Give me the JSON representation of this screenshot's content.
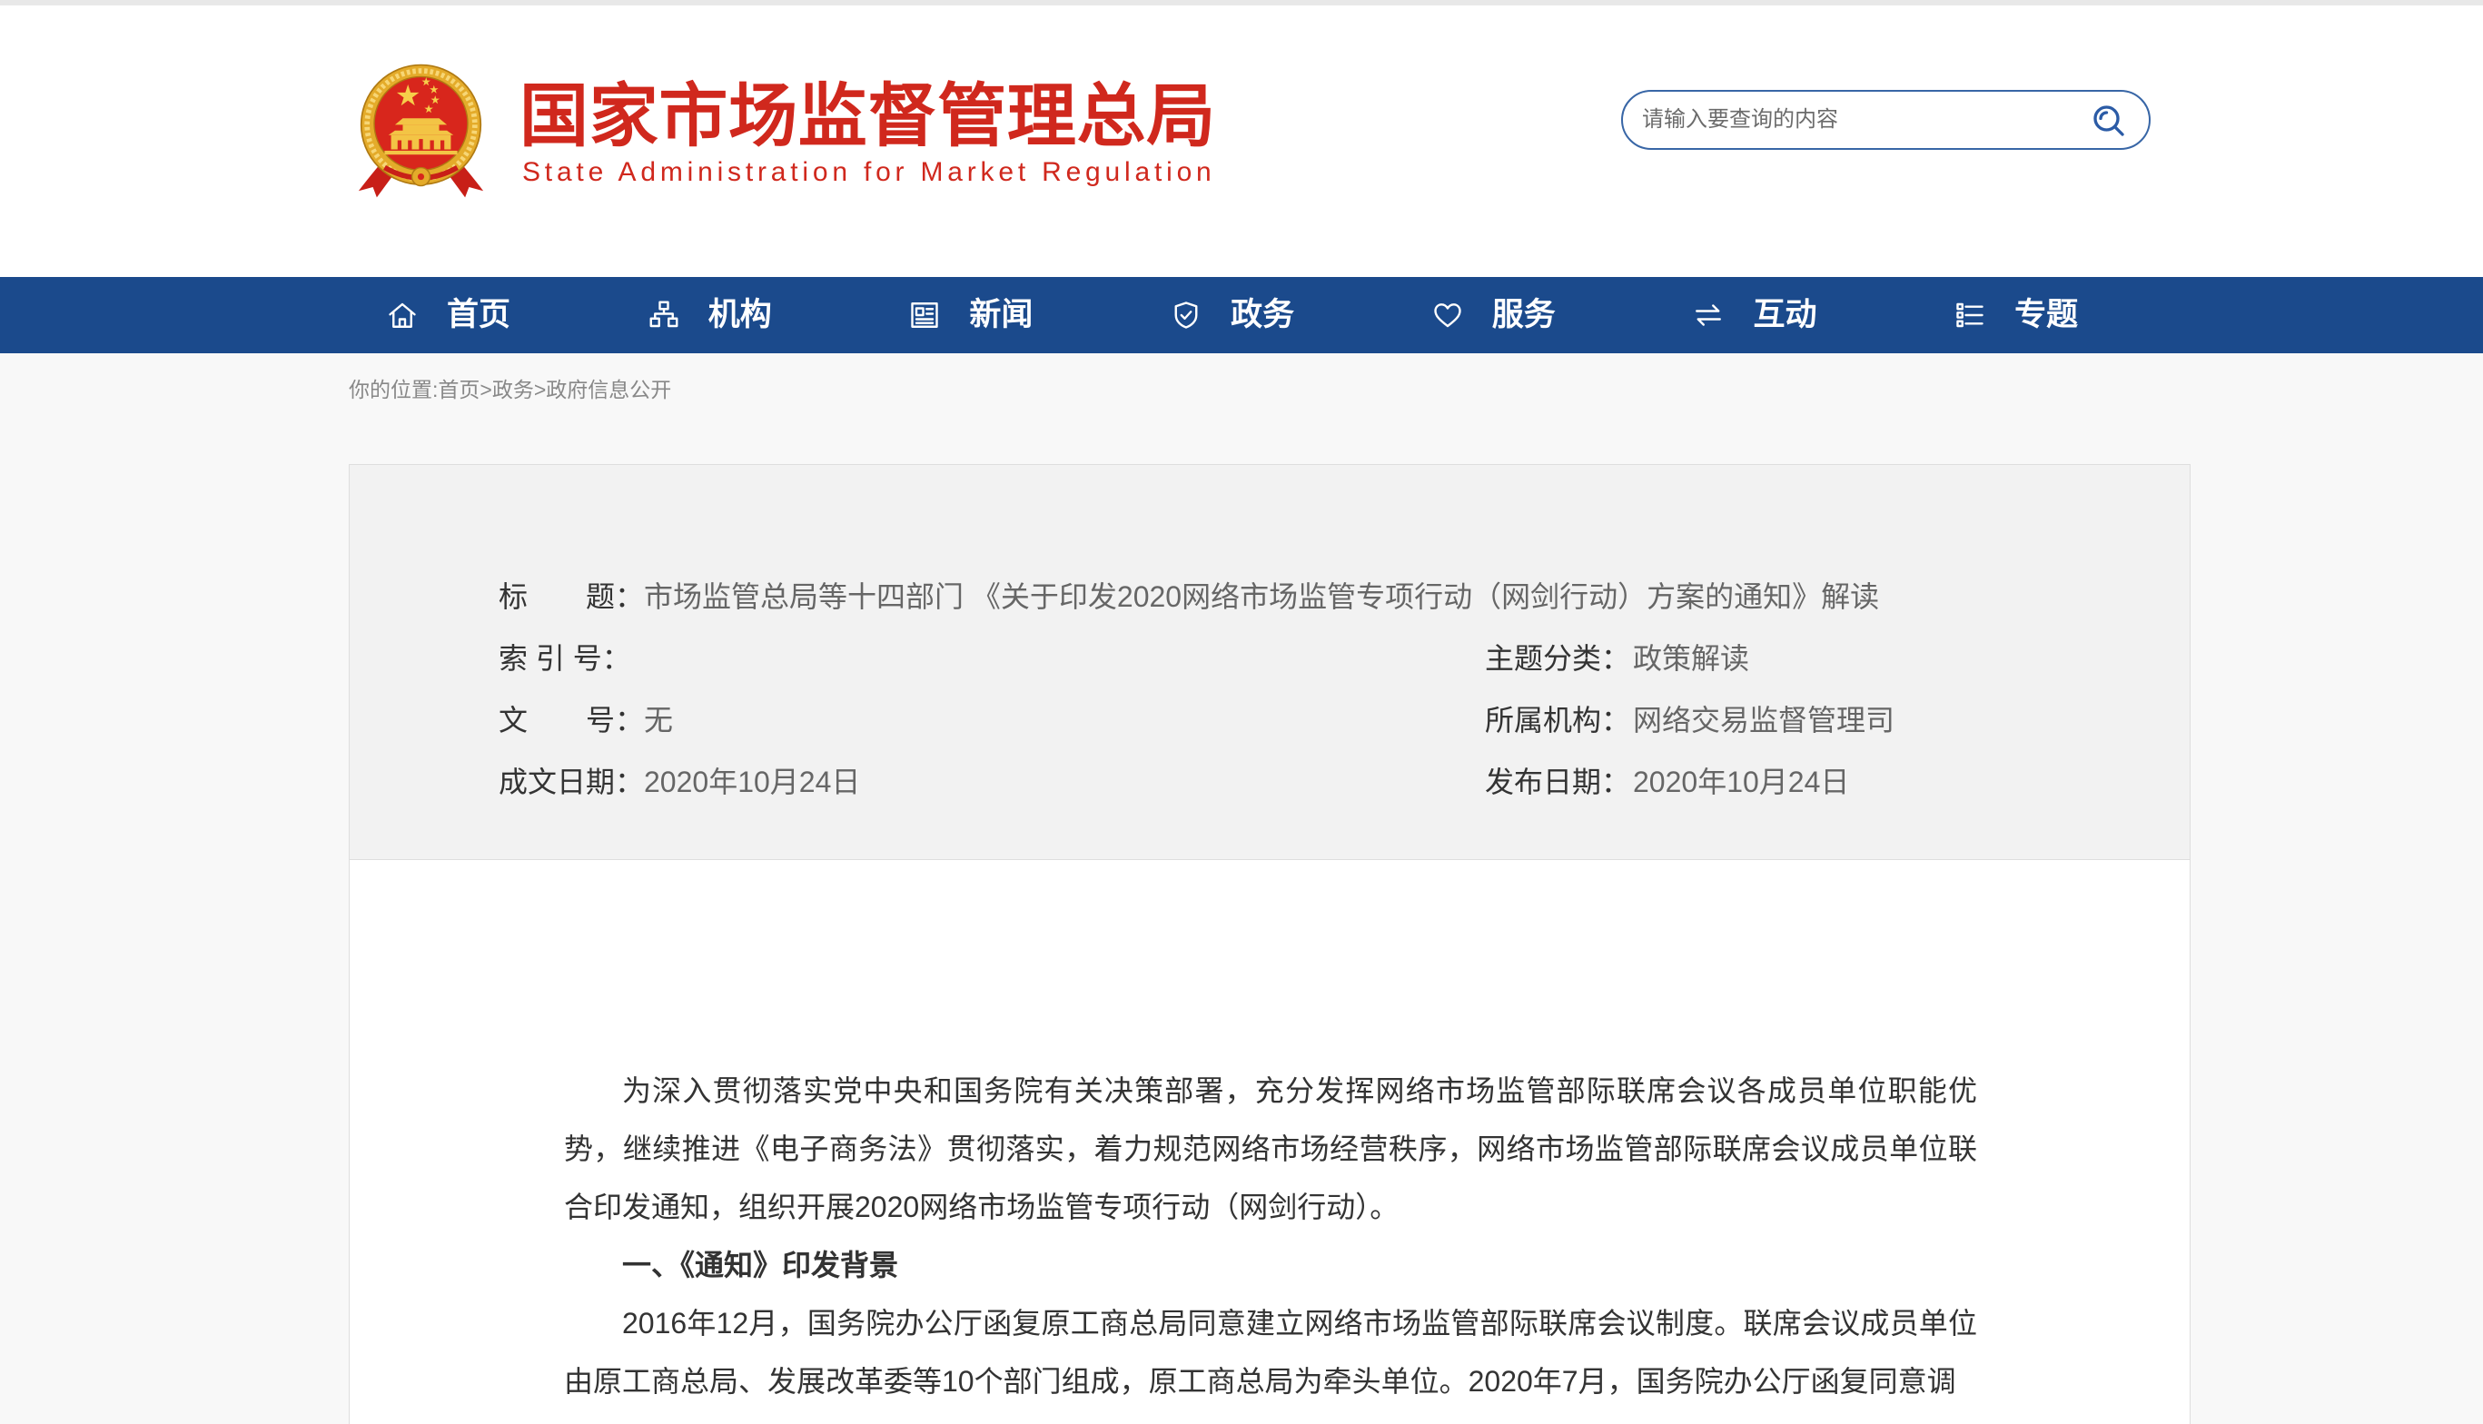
{
  "theme": {
    "brand_red": "#d0281d",
    "nav_blue": "#1b4a8c",
    "search_border": "#3866a6"
  },
  "header": {
    "logo_icon": "national-emblem-icon",
    "title_cn": "国家市场监督管理总局",
    "title_en": "State Administration for Market Regulation",
    "search": {
      "placeholder": "请输入要查询的内容",
      "icon": "search-icon"
    }
  },
  "nav": {
    "items": [
      {
        "label": "首页",
        "icon": "home-icon"
      },
      {
        "label": "机构",
        "icon": "org-chart-icon"
      },
      {
        "label": "新闻",
        "icon": "newspaper-icon"
      },
      {
        "label": "政务",
        "icon": "shield-check-icon"
      },
      {
        "label": "服务",
        "icon": "heart-icon"
      },
      {
        "label": "互动",
        "icon": "exchange-arrows-icon"
      },
      {
        "label": "专题",
        "icon": "checklist-icon"
      }
    ]
  },
  "breadcrumb": {
    "prefix": "你的位置:",
    "separator": ">",
    "items": [
      "首页",
      "政务",
      "政府信息公开"
    ]
  },
  "info": {
    "title": {
      "label": "标　　题：",
      "value": "市场监管总局等十四部门 《关于印发2020网络市场监管专项行动（网剑行动）方案的通知》解读"
    },
    "index_no": {
      "label": "索 引 号："
    },
    "category": {
      "label": "主题分类：",
      "value": "政策解读"
    },
    "doc_no": {
      "label": "文　　号：",
      "value": "无"
    },
    "agency": {
      "label": "所属机构：",
      "value": "网络交易监督管理司"
    },
    "written_date": {
      "label": "成文日期：",
      "value": "2020年10月24日"
    },
    "publish_date": {
      "label": "发布日期：",
      "value": "2020年10月24日"
    }
  },
  "article": {
    "intro": "为深入贯彻落实党中央和国务院有关决策部署，充分发挥网络市场监管部际联席会议各成员单位职能优势，继续推进《电子商务法》贯彻落实，着力规范网络市场经营秩序，网络市场监管部际联席会议成员单位联合印发通知，组织开展2020网络市场监管专项行动（网剑行动）。",
    "section_1_heading": "一、《通知》印发背景",
    "section_1_text": "2016年12月，国务院办公厅函复原工商总局同意建立网络市场监管部际联席会议制度。联席会议成员单位由原工商总局、发展改革委等10个部门组成，原工商总局为牵头单位。2020年7月，国务院办公厅函复同意调"
  }
}
